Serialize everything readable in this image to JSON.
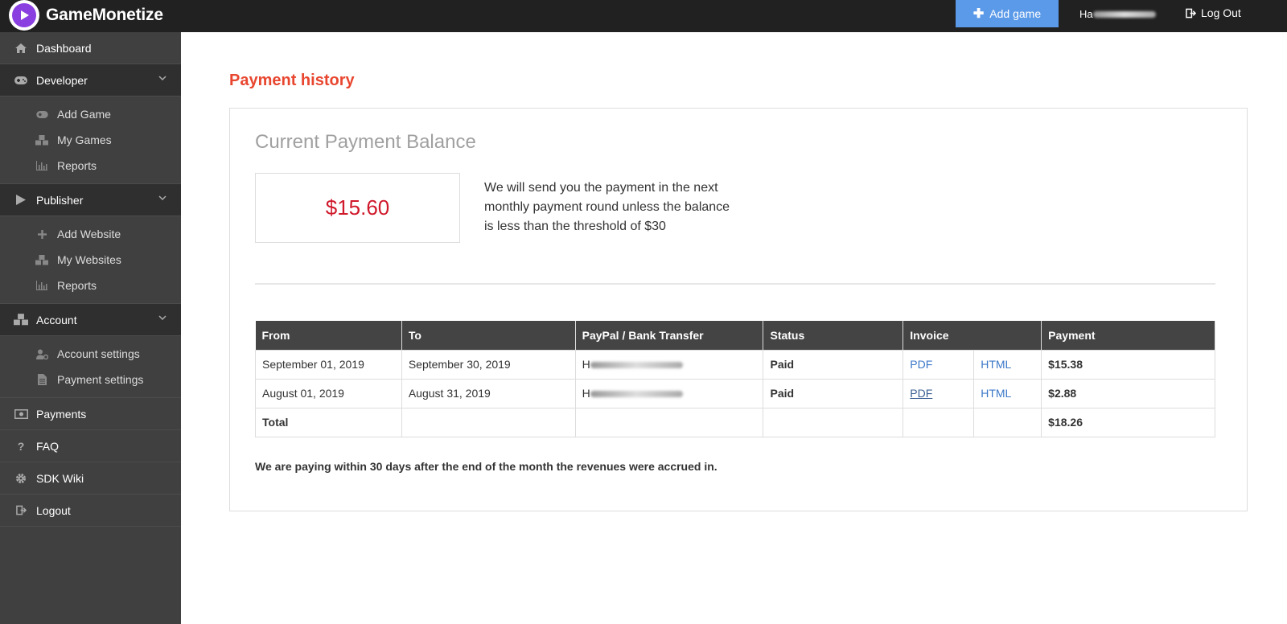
{
  "app": {
    "name": "GameMonetize"
  },
  "topbar": {
    "add_game_label": "Add game",
    "user_name": "Ha",
    "logout_label": "Log Out"
  },
  "sidebar": {
    "dashboard": "Dashboard",
    "developer": "Developer",
    "developer_items": [
      "Add Game",
      "My Games",
      "Reports"
    ],
    "publisher": "Publisher",
    "publisher_items": [
      "Add Website",
      "My Websites",
      "Reports"
    ],
    "account": "Account",
    "account_items": [
      "Account settings",
      "Payment settings"
    ],
    "payments": "Payments",
    "faq": "FAQ",
    "sdk_wiki": "SDK Wiki",
    "logout": "Logout"
  },
  "main": {
    "title": "Payment history",
    "balance_heading": "Current Payment Balance",
    "balance_amount": "$15.60",
    "balance_note": "We will send you the payment in the next monthly payment round unless the balance is less than the threshold of $30",
    "table": {
      "headers": [
        "From",
        "To",
        "PayPal / Bank Transfer",
        "Status",
        "Invoice",
        "Payment"
      ],
      "rows": [
        {
          "from": "September 01, 2019",
          "to": "September 30, 2019",
          "account": "H",
          "status": "Paid",
          "pdf": "PDF",
          "html": "HTML",
          "payment": "$15.38"
        },
        {
          "from": "August 01, 2019",
          "to": "August 31, 2019",
          "account": "H",
          "status": "Paid",
          "pdf": "PDF",
          "html": "HTML",
          "payment": "$2.88"
        }
      ],
      "total_label": "Total",
      "total_payment": "$18.26"
    },
    "pay_note": "We are paying within 30 days after the end of the month the revenues were accrued in."
  },
  "colors": {
    "accent": "#e8462f",
    "balance": "#d0192b",
    "button": "#5b9ae8",
    "topbar": "#212121",
    "sidebar": "#404040"
  }
}
